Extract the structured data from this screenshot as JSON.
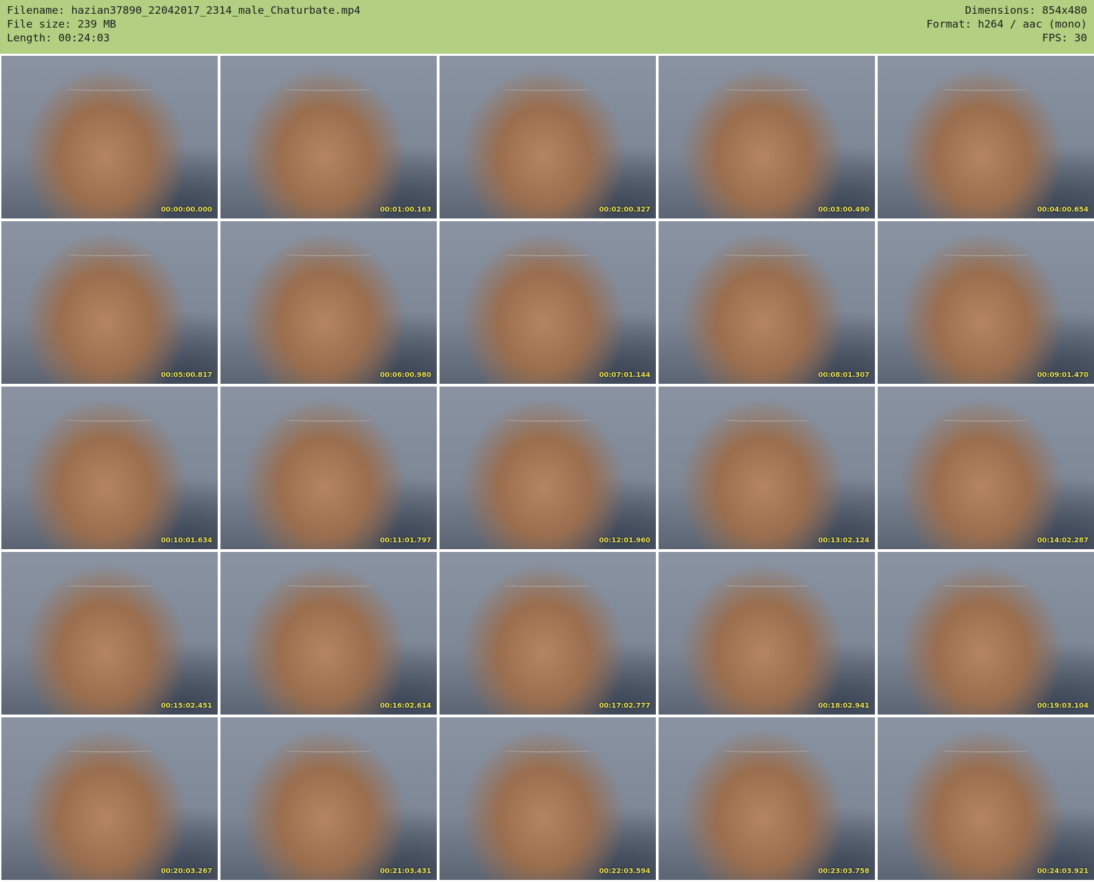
{
  "header": {
    "filename": "Filename: hazian37890_22042017_2314_male_Chaturbate.mp4",
    "file_size": "File size: 239 MB",
    "length": "Length: 00:24:03",
    "dimensions": "Dimensions: 854x480",
    "format": "Format: h264 / aac (mono)",
    "fps": "FPS: 30"
  },
  "thumbnails": [
    {
      "timestamp": "00:00:00.000"
    },
    {
      "timestamp": "00:01:00.163"
    },
    {
      "timestamp": "00:02:00.327"
    },
    {
      "timestamp": "00:03:00.490"
    },
    {
      "timestamp": "00:04:00.654"
    },
    {
      "timestamp": "00:05:00.817"
    },
    {
      "timestamp": "00:06:00.980"
    },
    {
      "timestamp": "00:07:01.144"
    },
    {
      "timestamp": "00:08:01.307"
    },
    {
      "timestamp": "00:09:01.470"
    },
    {
      "timestamp": "00:10:01.634"
    },
    {
      "timestamp": "00:11:01.797"
    },
    {
      "timestamp": "00:12:01.960"
    },
    {
      "timestamp": "00:13:02.124"
    },
    {
      "timestamp": "00:14:02.287"
    },
    {
      "timestamp": "00:15:02.451"
    },
    {
      "timestamp": "00:16:02.614"
    },
    {
      "timestamp": "00:17:02.777"
    },
    {
      "timestamp": "00:18:02.941"
    },
    {
      "timestamp": "00:19:03.104"
    },
    {
      "timestamp": "00:20:03.267"
    },
    {
      "timestamp": "00:21:03.431"
    },
    {
      "timestamp": "00:22:03.594"
    },
    {
      "timestamp": "00:23:03.758"
    },
    {
      "timestamp": "00:24:03.921"
    }
  ]
}
